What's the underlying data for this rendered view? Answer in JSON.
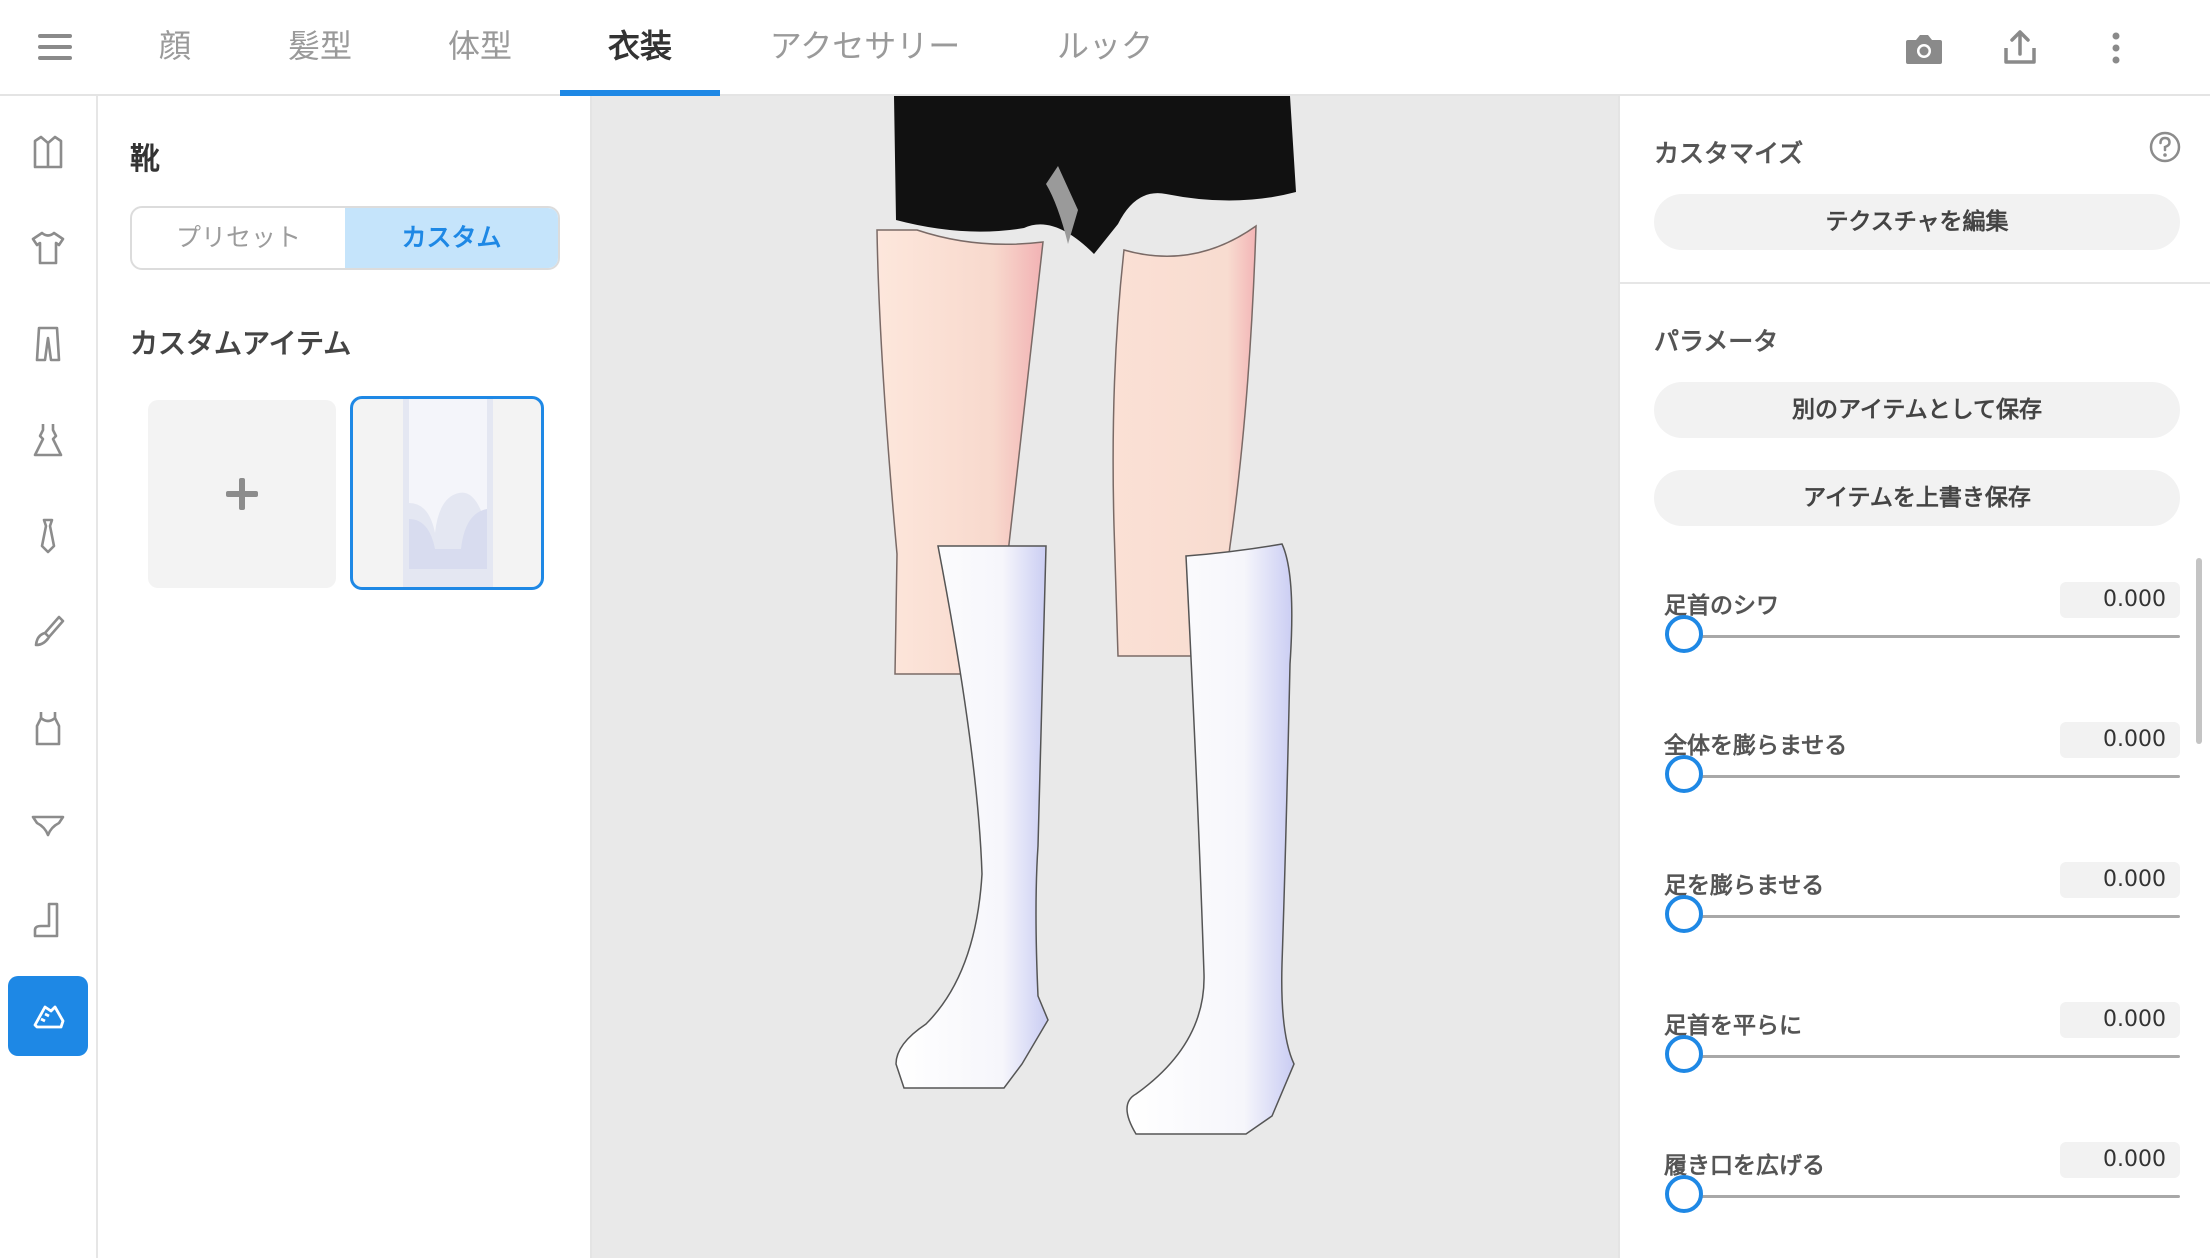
{
  "colors": {
    "accent": "#1e88e5",
    "accent_light": "#c5e4fb",
    "viewport_bg": "#e9e9e9"
  },
  "header": {
    "menu_icon": "hamburger-icon",
    "tabs": [
      {
        "label": "顔",
        "active": false
      },
      {
        "label": "髪型",
        "active": false
      },
      {
        "label": "体型",
        "active": false
      },
      {
        "label": "衣装",
        "active": true
      },
      {
        "label": "アクセサリー",
        "active": false
      },
      {
        "label": "ルック",
        "active": false
      }
    ],
    "actions": [
      "camera-icon",
      "share-icon",
      "more-vert-icon"
    ]
  },
  "rail": {
    "items": [
      "jacket-icon",
      "tshirt-icon",
      "pants-icon",
      "dress-icon",
      "necktie-icon",
      "brush-icon",
      "tank-top-icon",
      "underwear-icon",
      "sock-icon",
      "shoe-icon"
    ],
    "active_index": 9
  },
  "left_panel": {
    "title": "靴",
    "segments": {
      "preset": "プリセット",
      "custom": "カスタム",
      "active": "custom"
    },
    "section_label": "カスタムアイテム",
    "add_symbol": "+"
  },
  "right_panel": {
    "customize_label": "カスタマイズ",
    "edit_texture_button": "テクスチャを編集",
    "parameters_label": "パラメータ",
    "save_as_new_button": "別のアイテムとして保存",
    "overwrite_button": "アイテムを上書き保存",
    "params": [
      {
        "label": "足首のシワ",
        "value": "0.000",
        "level": 0
      },
      {
        "label": "全体を膨らませる",
        "value": "0.000",
        "level": 0
      },
      {
        "label": "足を膨らませる",
        "value": "0.000",
        "level": 0
      },
      {
        "label": "足首を平らに",
        "value": "0.000",
        "level": 0
      },
      {
        "label": "履き口を広げる",
        "value": "0.000",
        "level": 0
      }
    ]
  }
}
